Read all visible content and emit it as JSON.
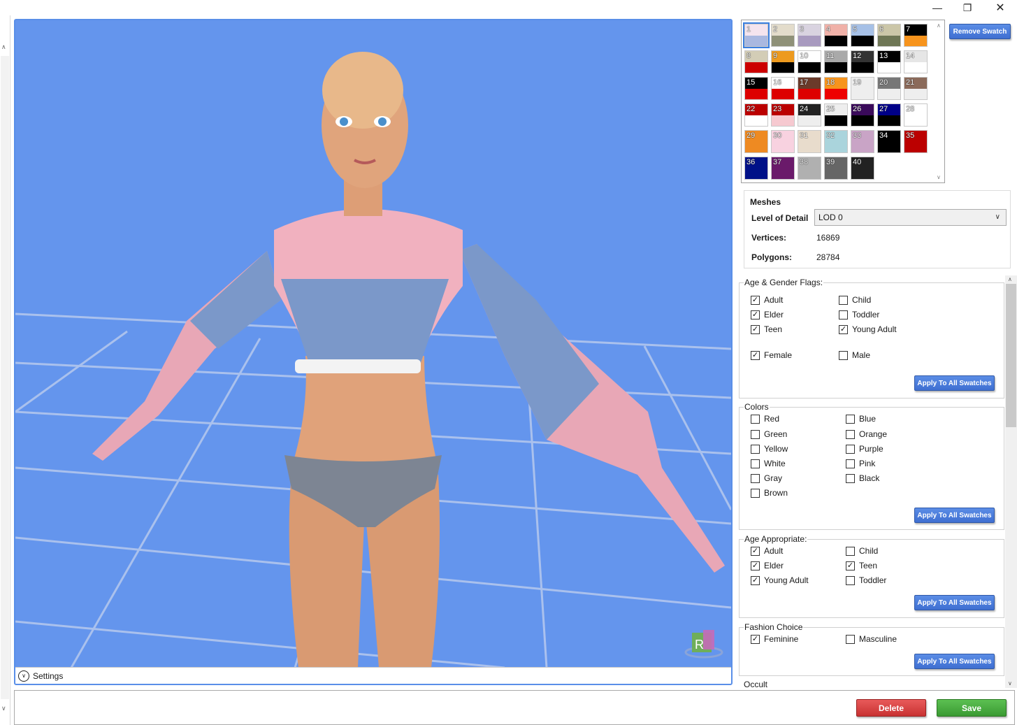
{
  "window": {
    "minimize_icon": "minimize-icon",
    "restore_icon": "restore-icon",
    "close_icon": "close-icon"
  },
  "viewport": {
    "settings_label": "Settings",
    "background_color": "#6495ed",
    "gizmo_label": "R"
  },
  "swatches": {
    "remove_label": "Remove Swatch",
    "items": [
      {
        "n": "1",
        "top": "#f4e4ee",
        "bot": "#a9b8e0"
      },
      {
        "n": "2",
        "top": "#e3dccb",
        "bot": "#8f9178"
      },
      {
        "n": "3",
        "top": "#d9d3e0",
        "bot": "#a89abf"
      },
      {
        "n": "4",
        "top": "#f0b1a8",
        "bot": "#000000"
      },
      {
        "n": "5",
        "top": "#a6c0e6",
        "bot": "#000000"
      },
      {
        "n": "6",
        "top": "#cbc6a8",
        "bot": "#6e7655"
      },
      {
        "n": "7",
        "top": "#000000",
        "bot": "#f7941d"
      },
      {
        "n": "8",
        "top": "#d3cdb6",
        "bot": "#cc0000"
      },
      {
        "n": "9",
        "top": "#ed9a1f",
        "bot": "#000000"
      },
      {
        "n": "10",
        "top": "#ffffff",
        "bot": "#000000"
      },
      {
        "n": "11",
        "top": "#a9a9a9",
        "bot": "#000000"
      },
      {
        "n": "12",
        "top": "#333333",
        "bot": "#000000"
      },
      {
        "n": "13",
        "top": "#000000",
        "bot": "#ffffff"
      },
      {
        "n": "14",
        "top": "#e6e6e6",
        "bot": "#ffffff"
      },
      {
        "n": "15",
        "top": "#000000",
        "bot": "#dd0000"
      },
      {
        "n": "16",
        "top": "#ffffff",
        "bot": "#dd0000"
      },
      {
        "n": "17",
        "top": "#6b3a2a",
        "bot": "#dd0000"
      },
      {
        "n": "18",
        "top": "#f7941d",
        "bot": "#ee0000"
      },
      {
        "n": "19",
        "top": "#eeeeee",
        "bot": "#eeeeee"
      },
      {
        "n": "20",
        "top": "#777777",
        "bot": "#eeeeee"
      },
      {
        "n": "21",
        "top": "#8b6a5a",
        "bot": "#eeeeee"
      },
      {
        "n": "22",
        "top": "#bb0000",
        "bot": "#ffffff"
      },
      {
        "n": "23",
        "top": "#bb0000",
        "bot": "#f6c9d0"
      },
      {
        "n": "24",
        "top": "#222222",
        "bot": "#eeeeee"
      },
      {
        "n": "25",
        "top": "#eeeeee",
        "bot": "#000000"
      },
      {
        "n": "26",
        "top": "#3a0a5a",
        "bot": "#000000"
      },
      {
        "n": "27",
        "top": "#000088",
        "bot": "#000000"
      },
      {
        "n": "28",
        "top": "#ffffff",
        "bot": "#ffffff"
      },
      {
        "n": "29",
        "top": "#ee8a22",
        "bot": "#ee8a22"
      },
      {
        "n": "30",
        "top": "#f8d2e0",
        "bot": "#f8d2e0"
      },
      {
        "n": "31",
        "top": "#e8dccc",
        "bot": "#e8dccc"
      },
      {
        "n": "32",
        "top": "#aad4dc",
        "bot": "#aad4dc"
      },
      {
        "n": "33",
        "top": "#c9a4c6",
        "bot": "#c9a4c6"
      },
      {
        "n": "34",
        "top": "#000000",
        "bot": "#000000"
      },
      {
        "n": "35",
        "top": "#bb0000",
        "bot": "#bb0000"
      },
      {
        "n": "36",
        "top": "#001188",
        "bot": "#001188"
      },
      {
        "n": "37",
        "top": "#6a1a6a",
        "bot": "#6a1a6a"
      },
      {
        "n": "38",
        "top": "#b0b0b0",
        "bot": "#b0b0b0"
      },
      {
        "n": "39",
        "top": "#666666",
        "bot": "#666666"
      },
      {
        "n": "40",
        "top": "#222222",
        "bot": "#222222"
      }
    ]
  },
  "meshes": {
    "title": "Meshes",
    "lod_label": "Level of Detail",
    "lod_value": "LOD 0",
    "vertices_label": "Vertices:",
    "vertices_value": "16869",
    "polygons_label": "Polygons:",
    "polygons_value": "28784"
  },
  "age_gender": {
    "title": "Age & Gender Flags:",
    "apply_label": "Apply To All Swatches",
    "items": [
      {
        "label": "Adult",
        "checked": true
      },
      {
        "label": "Child",
        "checked": false
      },
      {
        "label": "Elder",
        "checked": true
      },
      {
        "label": "Toddler",
        "checked": false
      },
      {
        "label": "Teen",
        "checked": true
      },
      {
        "label": "Young Adult",
        "checked": true
      },
      {
        "label": "Female",
        "checked": true
      },
      {
        "label": "Male",
        "checked": false
      }
    ]
  },
  "colors": {
    "title": "Colors",
    "apply_label": "Apply To All Swatches",
    "items": [
      {
        "label": "Red",
        "checked": false
      },
      {
        "label": "Blue",
        "checked": false
      },
      {
        "label": "Green",
        "checked": false
      },
      {
        "label": "Orange",
        "checked": false
      },
      {
        "label": "Yellow",
        "checked": false
      },
      {
        "label": "Purple",
        "checked": false
      },
      {
        "label": "White",
        "checked": false
      },
      {
        "label": "Pink",
        "checked": false
      },
      {
        "label": "Gray",
        "checked": false
      },
      {
        "label": "Black",
        "checked": false
      },
      {
        "label": "Brown",
        "checked": false
      }
    ]
  },
  "age_appropriate": {
    "title": "Age Appropriate:",
    "apply_label": "Apply To All Swatches",
    "items": [
      {
        "label": "Adult",
        "checked": true
      },
      {
        "label": "Child",
        "checked": false
      },
      {
        "label": "Elder",
        "checked": true
      },
      {
        "label": "Teen",
        "checked": true
      },
      {
        "label": "Young Adult",
        "checked": true
      },
      {
        "label": "Toddler",
        "checked": false
      }
    ]
  },
  "fashion": {
    "title": "Fashion Choice",
    "apply_label": "Apply To All Swatches",
    "items": [
      {
        "label": "Feminine",
        "checked": true
      },
      {
        "label": "Masculine",
        "checked": false
      }
    ]
  },
  "occult": {
    "title": "Occult"
  },
  "actions": {
    "delete_label": "Delete",
    "save_label": "Save",
    "delete_color": "#d84040",
    "save_color": "#4aaa42"
  }
}
